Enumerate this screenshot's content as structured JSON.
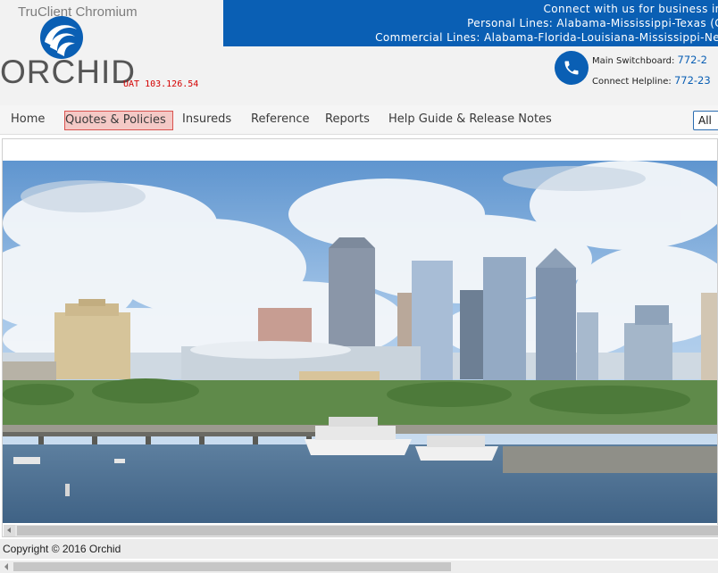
{
  "window": {
    "title": "TruClient Chromium"
  },
  "brand": {
    "logo_text": "ORCHID",
    "environment": "UAT 103.126.54"
  },
  "banner": {
    "line1": "Connect with us for business in t",
    "line2": "Personal Lines: Alabama-Mississippi-Texas (G",
    "line3": "Commercial Lines: Alabama-Florida-Louisiana-Mississippi-Ne"
  },
  "contact": {
    "switchboard_label": "Main Switchboard:",
    "switchboard_number": "772-2",
    "helpline_label": "Connect Helpline:",
    "helpline_number": "772-23"
  },
  "nav": {
    "items": [
      {
        "label": "Home"
      },
      {
        "label": "Quotes & Policies",
        "active": true
      },
      {
        "label": "Insureds"
      },
      {
        "label": "Reference"
      },
      {
        "label": "Reports"
      },
      {
        "label": "Help Guide & Release Notes"
      }
    ],
    "search_scope": "All"
  },
  "footer": {
    "copyright": "Copyright © 2016 Orchid"
  },
  "colors": {
    "brand_blue": "#0a5fb4",
    "env_red": "#d40000",
    "active_tab_bg": "#f4c9c6",
    "active_tab_border": "#d9534f"
  },
  "icons": [
    "orchid-wave-logo",
    "phone-icon",
    "scroll-left-arrow"
  ]
}
